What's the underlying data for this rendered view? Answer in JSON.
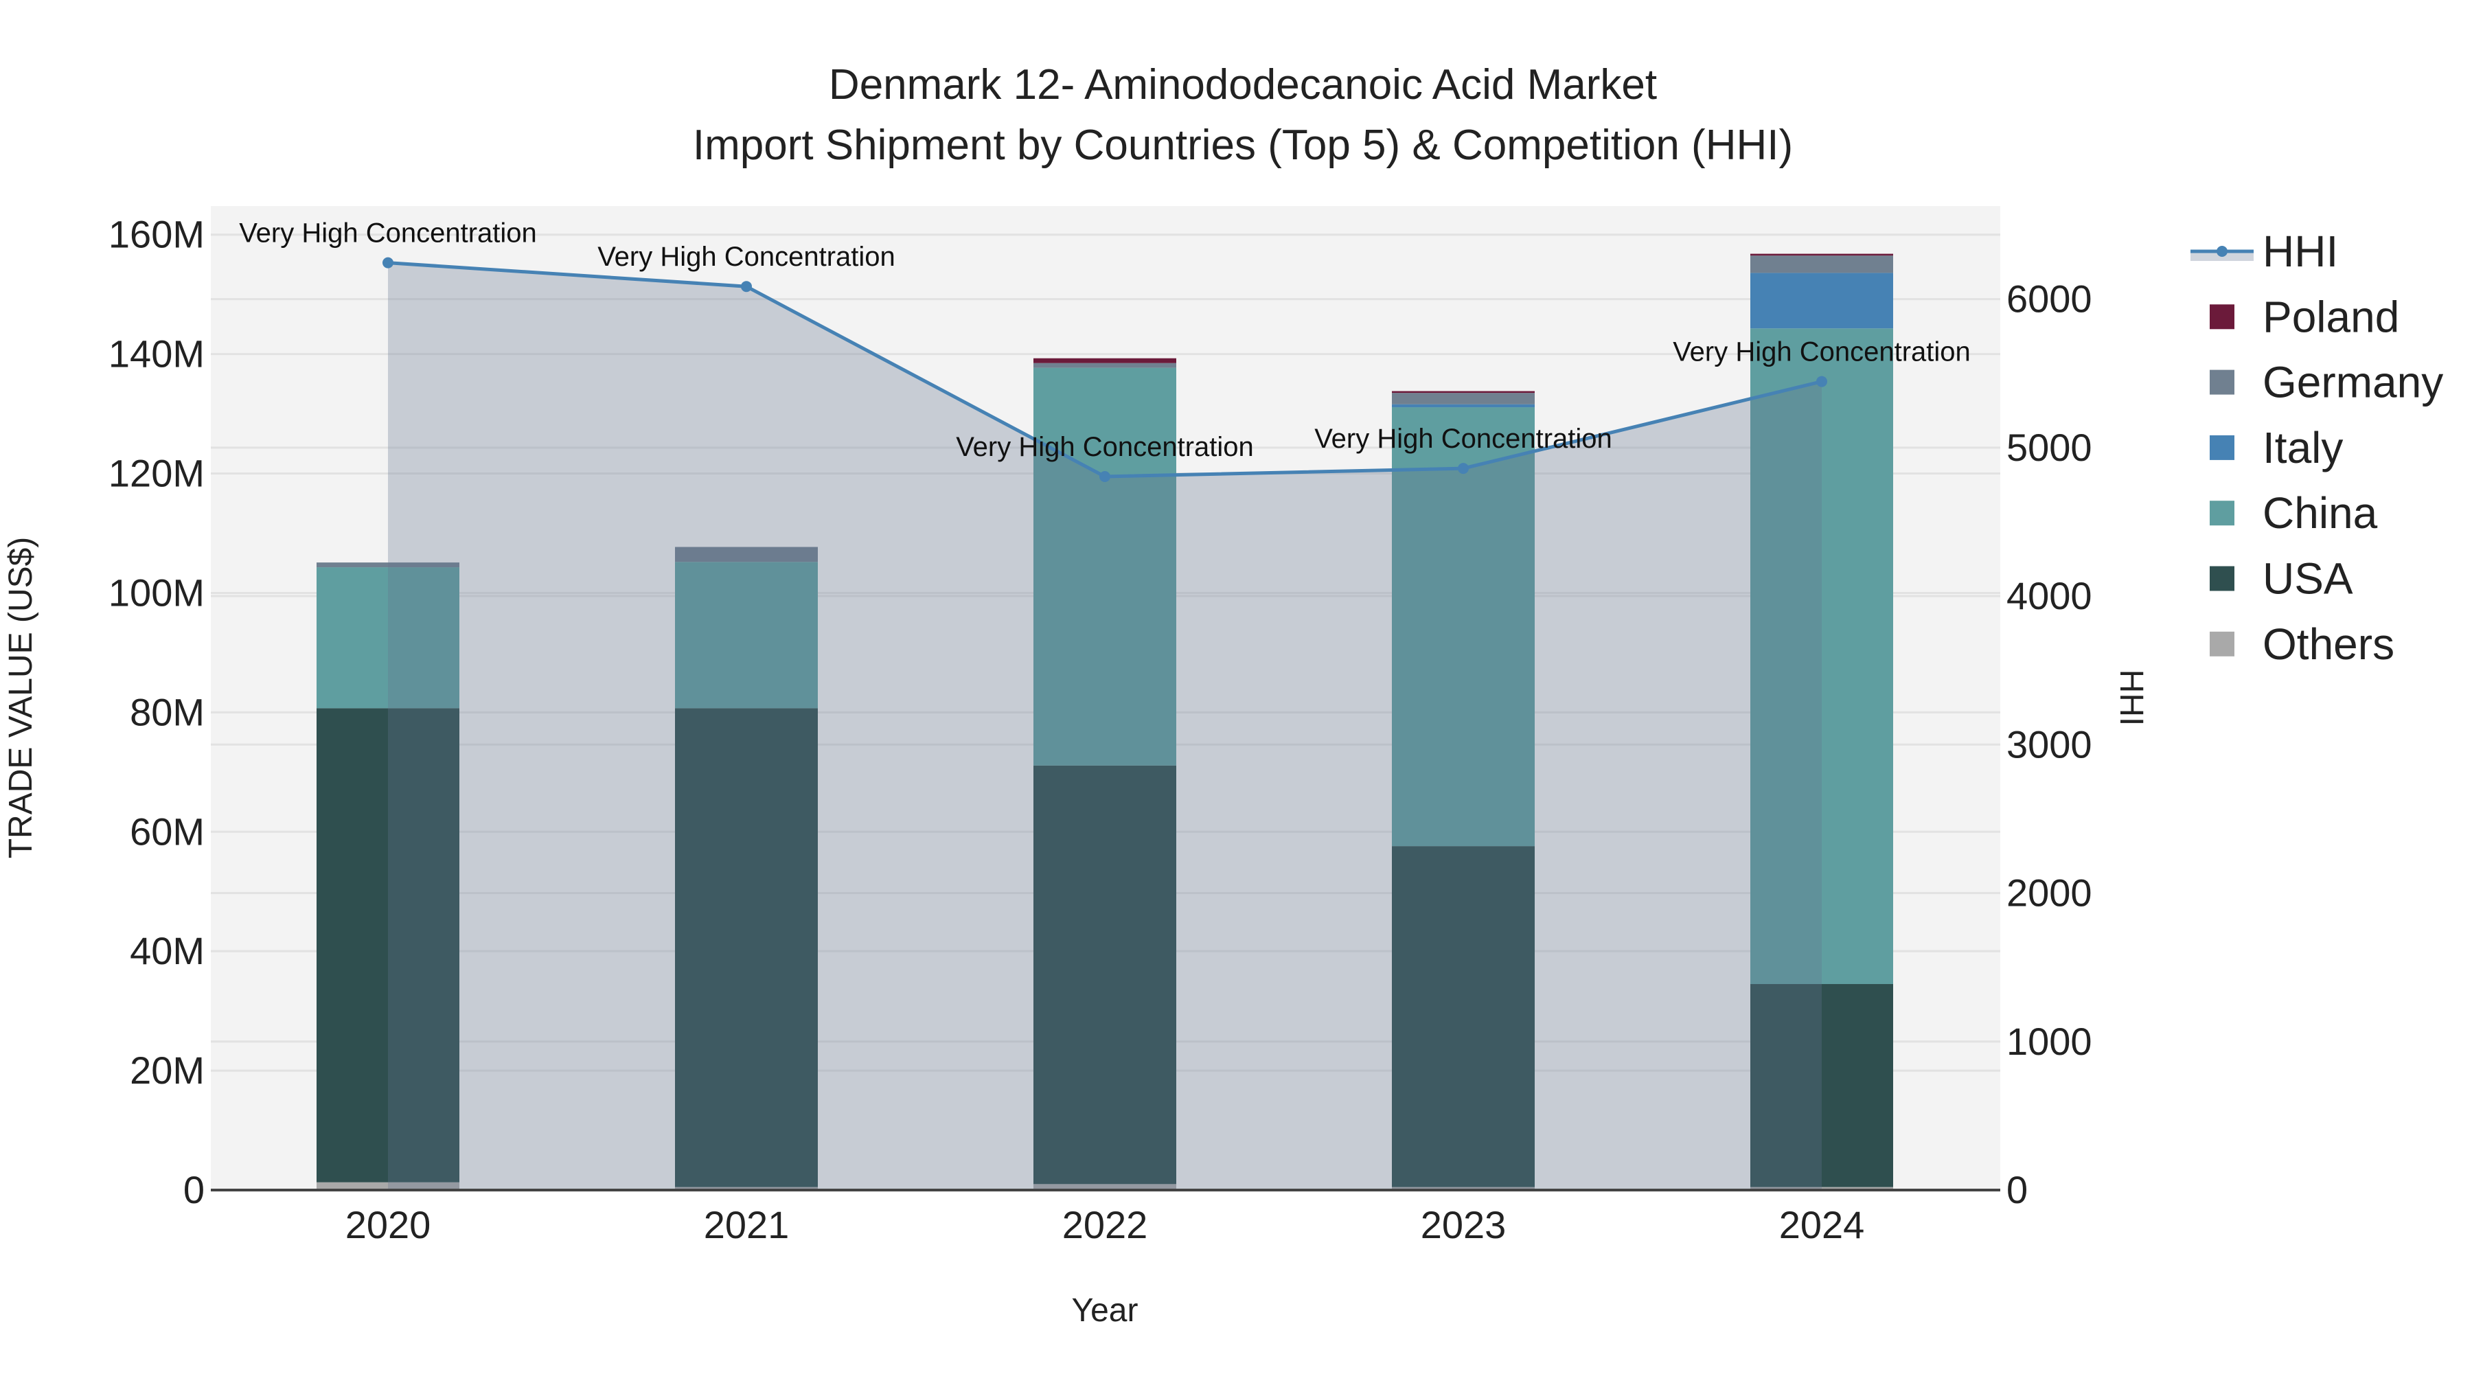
{
  "chart_data": {
    "type": "bar",
    "title_line1": "Denmark 12- Aminododecanoic Acid Market",
    "title_line2": "Import Shipment by Countries (Top 5) & Competition (HHI)",
    "xlabel": "Year",
    "ylabel": "TRADE VALUE (US$)",
    "y2label": "HHI",
    "categories": [
      "2020",
      "2021",
      "2022",
      "2023",
      "2024"
    ],
    "ylim": [
      0,
      164.8
    ],
    "y_ticks": [
      0,
      20,
      40,
      60,
      80,
      100,
      120,
      140,
      160
    ],
    "y_tick_labels": [
      "0",
      "20M",
      "40M",
      "60M",
      "80M",
      "100M",
      "120M",
      "140M",
      "160M"
    ],
    "y2lim": [
      0,
      6627
    ],
    "y2_ticks": [
      0,
      1000,
      2000,
      3000,
      4000,
      5000,
      6000
    ],
    "y2_tick_labels": [
      "0",
      "1000",
      "2000",
      "3000",
      "4000",
      "5000",
      "6000"
    ],
    "units": "Million US$",
    "series": [
      {
        "name": "Others",
        "color": "#a9a9a9",
        "values": [
          1.3,
          0.5,
          1.0,
          0.5,
          0.5
        ]
      },
      {
        "name": "USA",
        "color": "#2f4f4f",
        "values": [
          79.4,
          80.2,
          70.1,
          57.1,
          34.0
        ]
      },
      {
        "name": "China",
        "color": "#5f9ea0",
        "values": [
          23.6,
          24.5,
          66.6,
          73.5,
          109.8
        ]
      },
      {
        "name": "Italy",
        "color": "#4682b4",
        "values": [
          0,
          0,
          0,
          0.5,
          9.3
        ]
      },
      {
        "name": "Germany",
        "color": "#708090",
        "values": [
          0.8,
          2.5,
          0.8,
          1.9,
          2.9
        ]
      },
      {
        "name": "Poland",
        "color": "#6b1a3a",
        "values": [
          0,
          0,
          0.8,
          0.3,
          0.3
        ]
      }
    ],
    "hhi": {
      "name": "HHI",
      "color": "#4682b4",
      "values": [
        6245,
        6085,
        4805,
        4860,
        5445
      ],
      "annotations": [
        "Very High Concentration",
        "Very High Concentration",
        "Very High Concentration",
        "Very High Concentration",
        "Very High Concentration"
      ]
    },
    "legend": [
      "HHI",
      "Poland",
      "Germany",
      "Italy",
      "China",
      "USA",
      "Others"
    ],
    "legend_placement": "right",
    "grid": true
  }
}
